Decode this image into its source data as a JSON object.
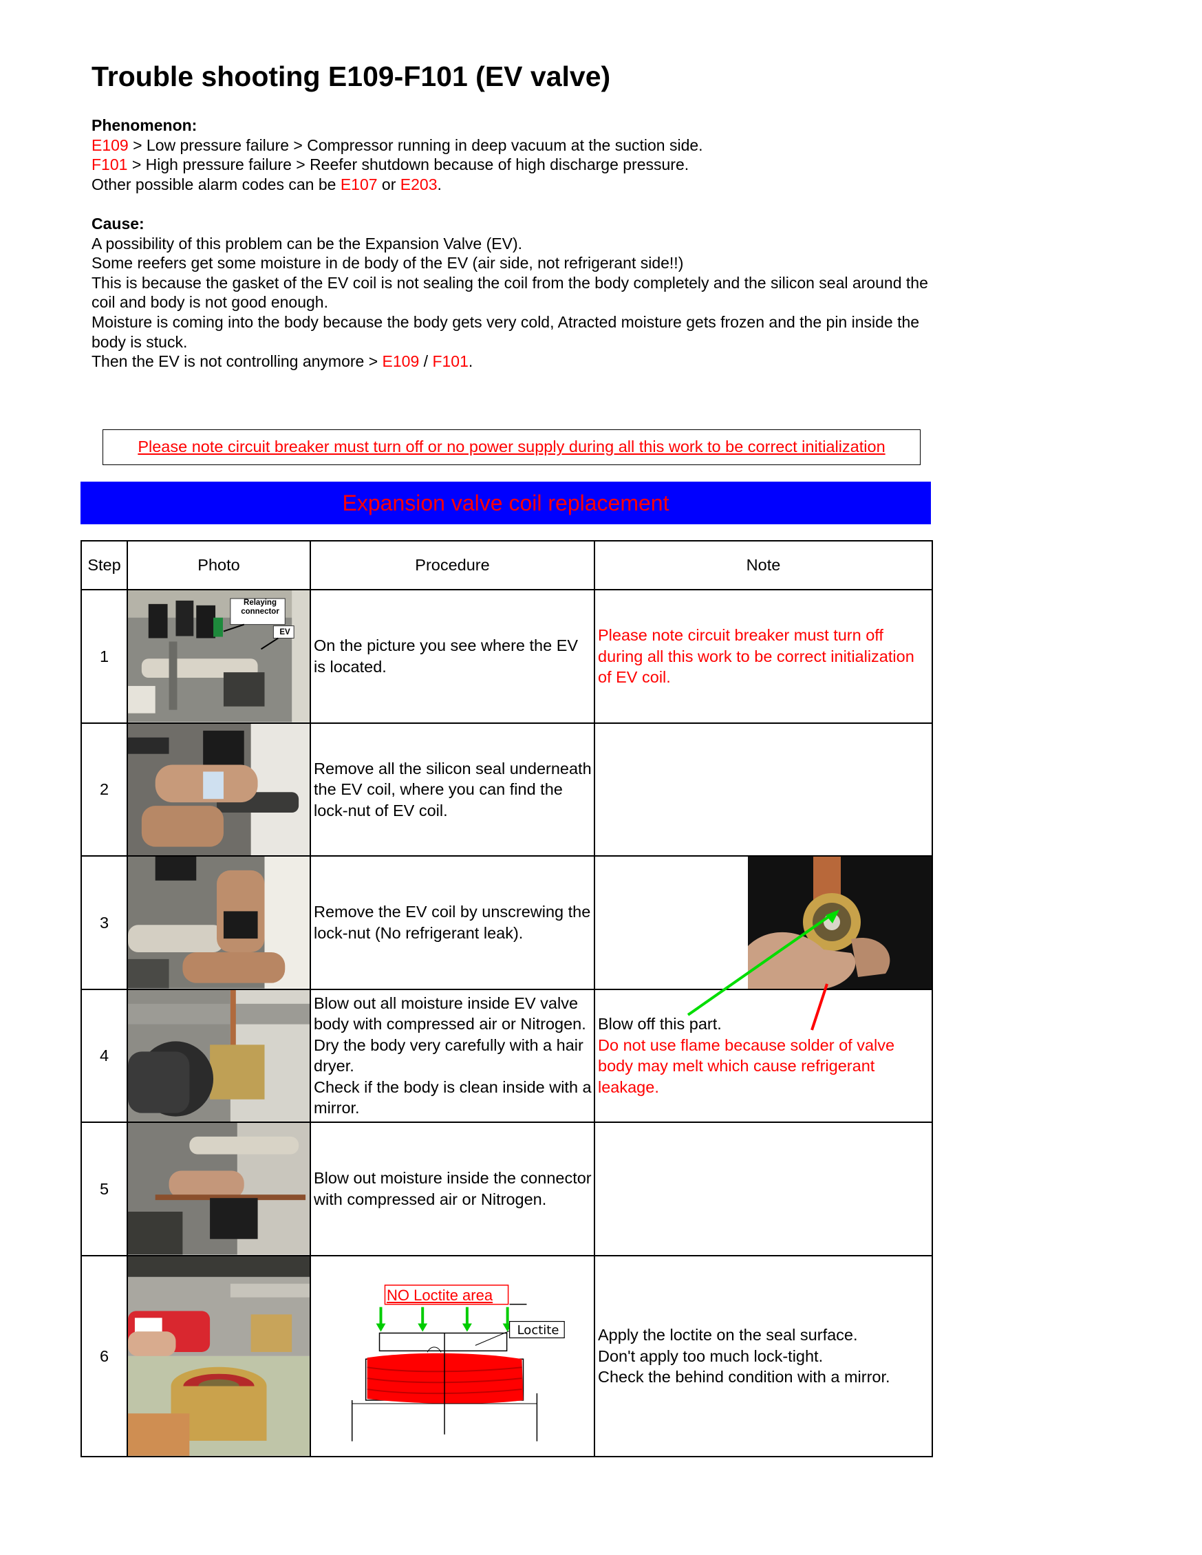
{
  "title": "Trouble shooting E109-F101 (EV valve)",
  "phenomenon": {
    "label": "Phenomenon:",
    "line1": {
      "code": "E109",
      "text": " > Low pressure failure > Compressor running in deep vacuum at the suction side."
    },
    "line2": {
      "code": "F101",
      "text": " > High pressure failure > Reefer shutdown because of high discharge pressure."
    },
    "line3": {
      "prefix": "Other possible alarm codes can be ",
      "code_a": "E107",
      "mid": " or ",
      "code_b": "E203",
      "suffix": "."
    }
  },
  "cause": {
    "label": "Cause:",
    "lines": [
      "A possibility of this problem can be the Expansion Valve (EV).",
      "Some reefers get some moisture in de body of the EV (air side, not refrigerant side!!)",
      "This is because the gasket of the EV coil is not sealing the coil from the body completely and the silicon seal around the coil and body is not good enough.",
      "Moisture is coming into the body because the body gets very cold, Atracted moisture gets frozen and the pin inside the body is stuck."
    ],
    "last": {
      "prefix": "Then the EV is not controlling anymore > ",
      "code_a": "E109",
      "sep": " / ",
      "code_b": "F101",
      "suffix": "."
    }
  },
  "notice": "Please note circuit breaker must turn off or no power supply during all this work to be correct initialization",
  "banner": "Expansion valve coil replacement",
  "table": {
    "headers": {
      "step": "Step",
      "photo": "Photo",
      "procedure": "Procedure",
      "note": "Note"
    },
    "rows": [
      {
        "step": "1",
        "procedure": "On the picture you see where the EV is located.",
        "note_red": "Please note circuit breaker must turn off during all this work to be correct initialization of EV coil.",
        "photo_labels": {
          "relaying": "Relaying connector",
          "ev": "EV"
        }
      },
      {
        "step": "2",
        "procedure": "Remove all the silicon seal underneath the EV coil, where you can find the lock-nut of EV coil."
      },
      {
        "step": "3",
        "procedure": "Remove the EV coil by unscrewing the lock-nut (No refrigerant leak)."
      },
      {
        "step": "4",
        "procedure_lines": [
          "Blow out all moisture inside EV valve body with compressed air or Nitrogen. Dry the body very carefully with a hair dryer.",
          "Check if the body is clean inside with a mirror."
        ],
        "note_black": "Blow off this part.",
        "note_red": "Do not use flame because solder of valve body may melt which cause refrigerant leakage."
      },
      {
        "step": "5",
        "procedure": "Blow out moisture inside the connector with compressed air or Nitrogen."
      },
      {
        "step": "6",
        "note_lines": [
          "Apply the loctite on the seal surface.",
          "Don't apply too much lock-tight.",
          "Check the behind condition with a mirror."
        ],
        "diagram": {
          "no_loctite": "NO Loctite area",
          "loctite": "Loctite"
        }
      }
    ]
  }
}
